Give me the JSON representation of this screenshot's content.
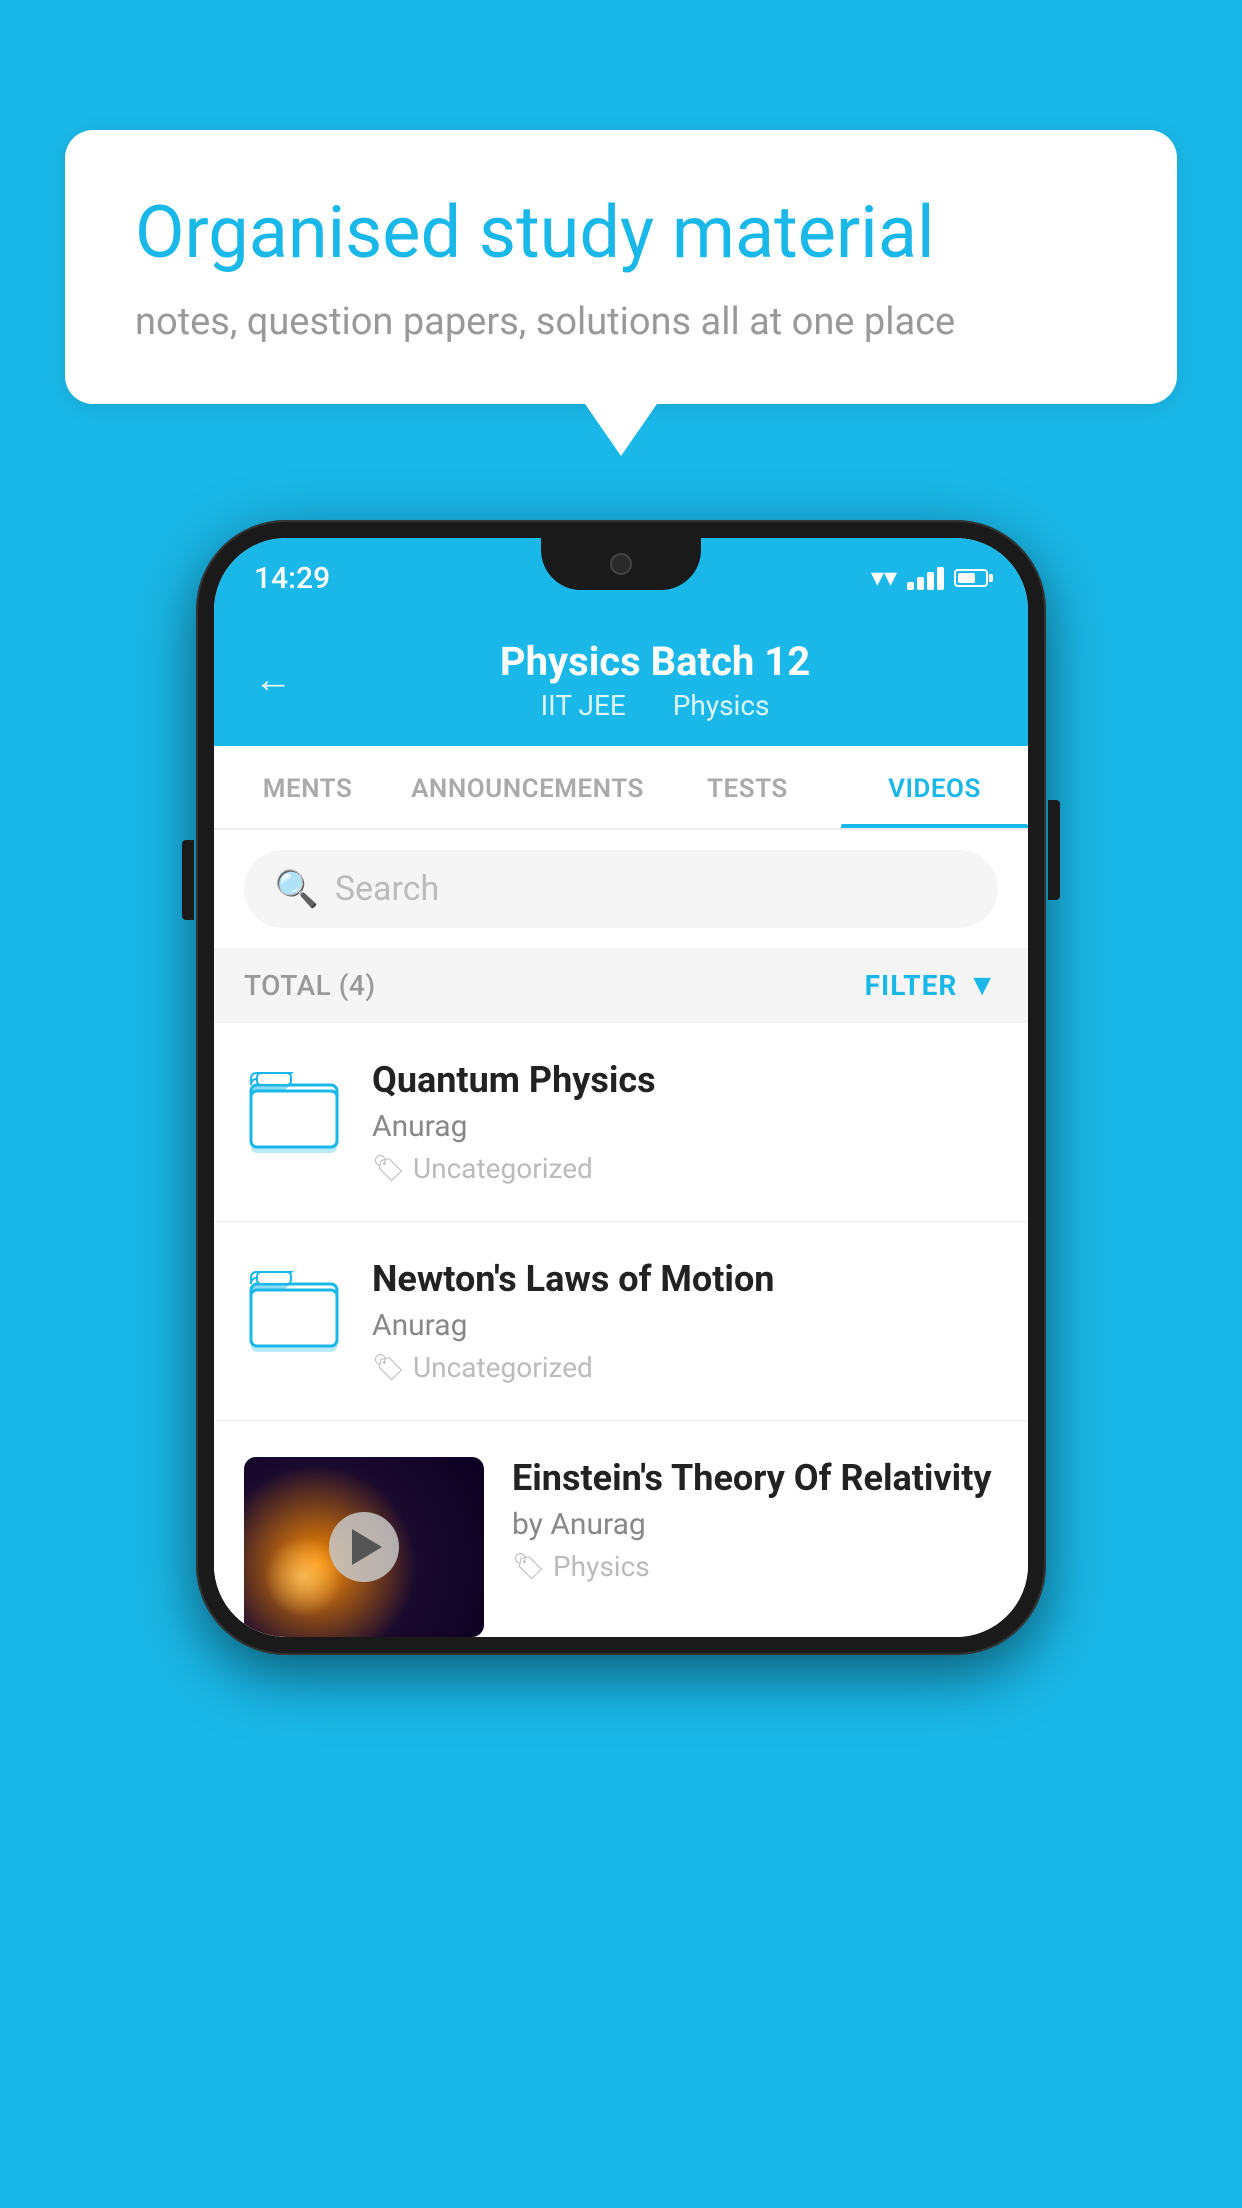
{
  "background_color": "#1ab8e8",
  "speech_bubble": {
    "title": "Organised study material",
    "subtitle": "notes, question papers, solutions all at one place"
  },
  "phone": {
    "status_bar": {
      "time": "14:29",
      "wifi": "▼",
      "signal": true,
      "battery": true
    },
    "header": {
      "back_label": "←",
      "title": "Physics Batch 12",
      "subtitle_part1": "IIT JEE",
      "subtitle_part2": "Physics"
    },
    "tabs": [
      {
        "label": "MENTS",
        "active": false
      },
      {
        "label": "ANNOUNCEMENTS",
        "active": false
      },
      {
        "label": "TESTS",
        "active": false
      },
      {
        "label": "VIDEOS",
        "active": true
      }
    ],
    "search": {
      "placeholder": "Search"
    },
    "filter_bar": {
      "total_label": "TOTAL (4)",
      "filter_label": "FILTER"
    },
    "videos": [
      {
        "title": "Quantum Physics",
        "author": "Anurag",
        "tag": "Uncategorized",
        "has_thumbnail": false
      },
      {
        "title": "Newton's Laws of Motion",
        "author": "Anurag",
        "tag": "Uncategorized",
        "has_thumbnail": false
      },
      {
        "title": "Einstein's Theory Of Relativity",
        "author": "by Anurag",
        "tag": "Physics",
        "has_thumbnail": true
      }
    ]
  }
}
